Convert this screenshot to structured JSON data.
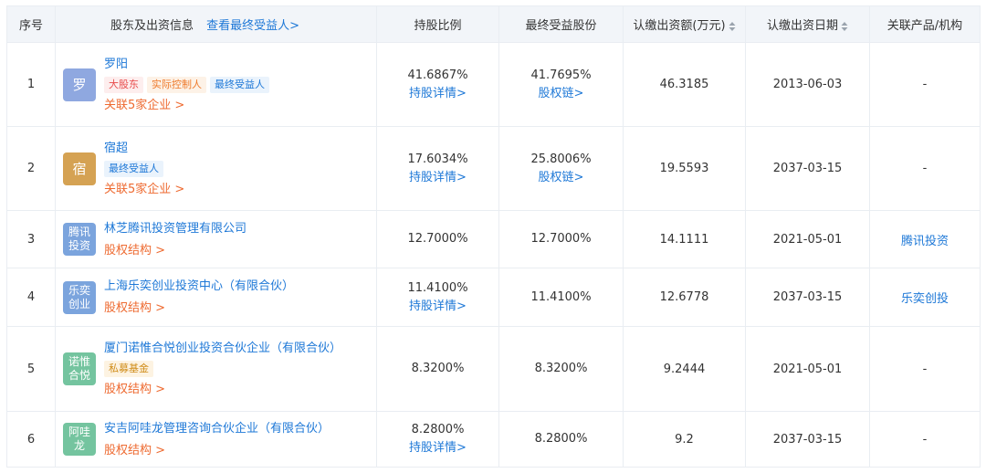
{
  "header": {
    "seq": "序号",
    "holder": "股东及出资信息",
    "view_ubo": "查看最终受益人>",
    "ratio": "持股比例",
    "ubo_share": "最终受益股份",
    "amount": "认缴出资额(万元)",
    "date": "认缴出资日期",
    "related": "关联产品/机构"
  },
  "colors": {
    "link": "#1e78d7",
    "orange_link": "#ee6a30",
    "header_bg": "#f2f5f9"
  },
  "rows": [
    {
      "seq": "1",
      "logo_text": [
        "罗"
      ],
      "logo_color": "#8fa8e0",
      "name": "罗阳",
      "tags": [
        {
          "text": "大股东",
          "style": "red"
        },
        {
          "text": "实际控制人",
          "style": "orange"
        },
        {
          "text": "最终受益人",
          "style": "blue"
        }
      ],
      "assoc": "关联5家企业 >",
      "ratio": "41.6867%",
      "ratio_link": "持股详情>",
      "ubo": "41.7695%",
      "ubo_link": "股权链>",
      "amount": "46.3185",
      "date": "2013-06-03",
      "related": "-"
    },
    {
      "seq": "2",
      "logo_text": [
        "宿"
      ],
      "logo_color": "#d5a253",
      "name": "宿超",
      "tags": [
        {
          "text": "最终受益人",
          "style": "blue"
        }
      ],
      "assoc": "关联5家企业 >",
      "ratio": "17.6034%",
      "ratio_link": "持股详情>",
      "ubo": "25.8006%",
      "ubo_link": "股权链>",
      "amount": "19.5593",
      "date": "2037-03-15",
      "related": "-"
    },
    {
      "seq": "3",
      "logo_text": [
        "腾讯",
        "投资"
      ],
      "logo_color": "#7ba4dd",
      "name": "林芝腾讯投资管理有限公司",
      "tags": [],
      "assoc": "股权结构 >",
      "ratio": "12.7000%",
      "ratio_link": "",
      "ubo": "12.7000%",
      "ubo_link": "",
      "amount": "14.1111",
      "date": "2021-05-01",
      "related": "腾讯投资"
    },
    {
      "seq": "4",
      "logo_text": [
        "乐奕",
        "创业"
      ],
      "logo_color": "#7ba4dd",
      "name": "上海乐奕创业投资中心（有限合伙）",
      "tags": [],
      "assoc": "股权结构 >",
      "ratio": "11.4100%",
      "ratio_link": "持股详情>",
      "ubo": "11.4100%",
      "ubo_link": "",
      "amount": "12.6778",
      "date": "2037-03-15",
      "related": "乐奕创投"
    },
    {
      "seq": "5",
      "logo_text": [
        "诺惟",
        "合悦"
      ],
      "logo_color": "#74c49f",
      "name": "厦门诺惟合悦创业投资合伙企业（有限合伙）",
      "tags": [
        {
          "text": "私募基金",
          "style": "gold"
        }
      ],
      "assoc": "股权结构 >",
      "ratio": "8.3200%",
      "ratio_link": "",
      "ubo": "8.3200%",
      "ubo_link": "",
      "amount": "9.2444",
      "date": "2021-05-01",
      "related": "-"
    },
    {
      "seq": "6",
      "logo_text": [
        "阿哇",
        "龙"
      ],
      "logo_color": "#74c49f",
      "name": "安吉阿哇龙管理咨询合伙企业（有限合伙）",
      "tags": [],
      "assoc": "股权结构 >",
      "ratio": "8.2800%",
      "ratio_link": "持股详情>",
      "ubo": "8.2800%",
      "ubo_link": "",
      "amount": "9.2",
      "date": "2037-03-15",
      "related": "-"
    }
  ]
}
